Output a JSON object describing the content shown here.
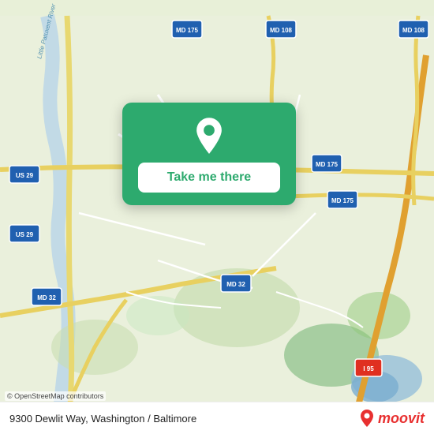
{
  "map": {
    "background_color": "#e8f0d8",
    "center_lat": 39.12,
    "center_lng": -76.82
  },
  "overlay": {
    "button_label": "Take me there",
    "pin_color": "#ffffff"
  },
  "bottom_bar": {
    "address": "9300 Dewlit Way, Washington / Baltimore",
    "osm_credit": "© OpenStreetMap contributors",
    "moovit_logo_text": "moovit"
  }
}
